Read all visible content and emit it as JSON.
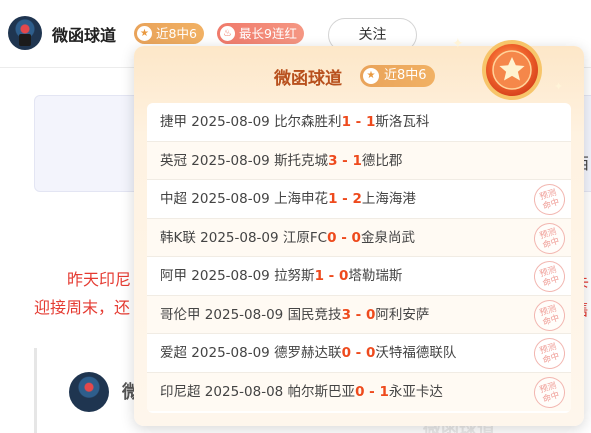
{
  "header": {
    "author_name": "微函球道",
    "badge_hit": "近8中6",
    "badge_streak": "最长9连红",
    "follow_label": "关注"
  },
  "background": {
    "line1": "昨天印尼",
    "line2": "迎接周末，还",
    "author_partial": "微",
    "right_glyph_1": "西",
    "right_glyph_2": "卡",
    "right_glyph_3": "售",
    "bottom_text": "微函球道"
  },
  "popover": {
    "title": "微函球道",
    "badge": "近8中6",
    "stamp_text": [
      "预测",
      "命中"
    ],
    "matches": [
      {
        "league": "捷甲",
        "date": "2025-08-09",
        "home": "比尔森胜利",
        "home_score": "1",
        "away_score": "1",
        "away": "斯洛瓦科",
        "hit": false
      },
      {
        "league": "英冠",
        "date": "2025-08-09",
        "home": "斯托克城",
        "home_score": "3",
        "away_score": "1",
        "away": "德比郡",
        "hit": false
      },
      {
        "league": "中超",
        "date": "2025-08-09",
        "home": "上海申花",
        "home_score": "1",
        "away_score": "2",
        "away": "上海海港",
        "hit": true
      },
      {
        "league": "韩K联",
        "date": "2025-08-09",
        "home": "江原FC",
        "home_score": "0",
        "away_score": "0",
        "away": "金泉尚武",
        "hit": true
      },
      {
        "league": "阿甲",
        "date": "2025-08-09",
        "home": "拉努斯",
        "home_score": "1",
        "away_score": "0",
        "away": "塔勒瑞斯",
        "hit": true
      },
      {
        "league": "哥伦甲",
        "date": "2025-08-09",
        "home": "国民竞技",
        "home_score": "3",
        "away_score": "0",
        "away": "阿利安萨",
        "hit": true
      },
      {
        "league": "爱超",
        "date": "2025-08-09",
        "home": "德罗赫达联",
        "home_score": "0",
        "away_score": "0",
        "away": "沃特福德联队",
        "hit": true
      },
      {
        "league": "印尼超",
        "date": "2025-08-08",
        "home": "帕尔斯巴亚",
        "home_score": "0",
        "away_score": "1",
        "away": "永亚卡达",
        "hit": true
      }
    ]
  },
  "colors": {
    "score": "#ee4a1d",
    "title": "#b8501d",
    "badge": "#e9a35a",
    "streak": "#f07a6b",
    "article_red": "#e53b32"
  },
  "icons": {
    "badge_hit": "star-icon",
    "badge_streak": "flame-icon",
    "medal": "star-medal-icon"
  }
}
